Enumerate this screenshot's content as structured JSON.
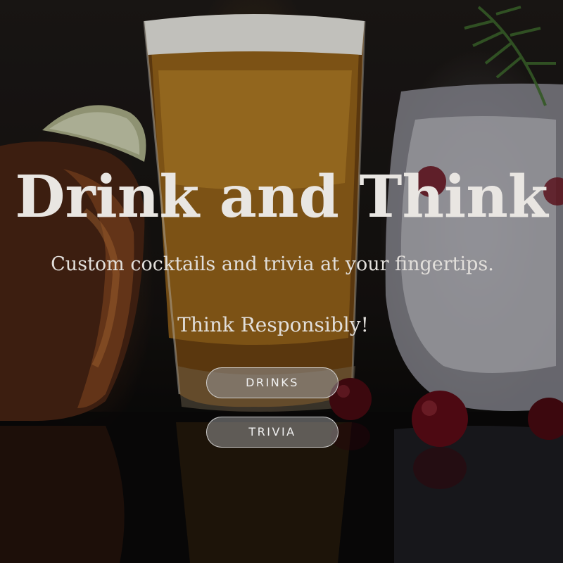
{
  "hero": {
    "title": "Drink and Think",
    "subtitle": "Custom cocktails and trivia at your fingertips.",
    "tagline": "Think Responsibly!"
  },
  "buttons": {
    "drinks_label": "DRINKS",
    "trivia_label": "TRIVIA"
  },
  "colors": {
    "text": "#e9e6e2",
    "button_fill": "#969696",
    "button_border": "#e1e1e1"
  }
}
